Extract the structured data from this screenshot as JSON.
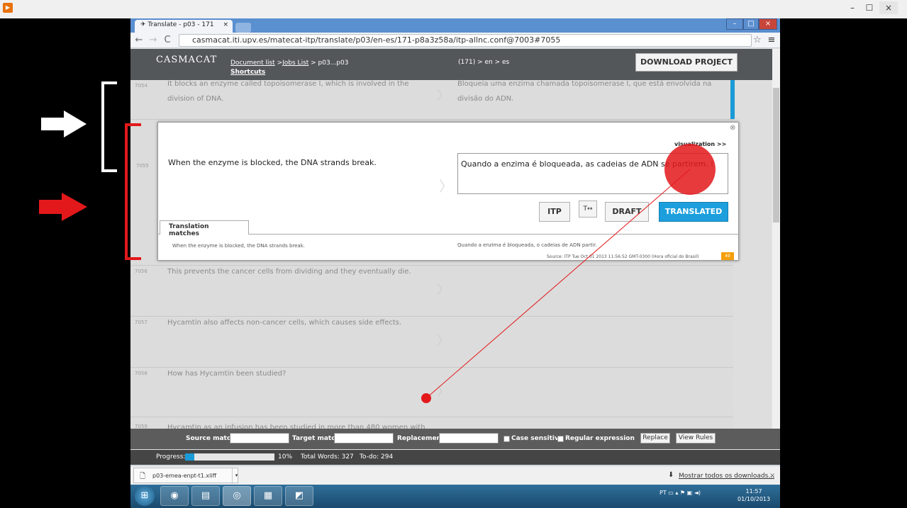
{
  "browser": {
    "tab_title": "Translate - p03 - 171",
    "tab_close": "×",
    "url": "casmacat.iti.upv.es/matecat-itp/translate/p03/en-es/171-p8a3z58a/itp-allnc.conf@7003#7055"
  },
  "header": {
    "logo_text": "CASMACAT",
    "breadcrumb_doclist": "Document list",
    "breadcrumb_sep1": " >",
    "breadcrumb_jobslist": "Jobs List",
    "breadcrumb_rest": " > p03...p03",
    "shortcuts": "Shortcuts",
    "lang_pair": "(171) > en > es",
    "download_label": "DOWNLOAD PROJECT"
  },
  "segments": [
    {
      "id": "7054",
      "source": "It blocks an enzyme called topoisomerase I, which is involved in the division of DNA.",
      "target": "Bloqueia uma enzima chamada topoisomerase I, que está envolvida na divisão do ADN."
    },
    {
      "id": "7056",
      "source": "This prevents the cancer cells from dividing and they eventually die.",
      "target": ""
    },
    {
      "id": "7057",
      "source": "Hycamtin also affects non-cancer cells, which causes side effects.",
      "target": ""
    },
    {
      "id": "7058",
      "source": "How has Hycamtin been studied?",
      "target": ""
    },
    {
      "id": "7059",
      "source": "Hycamtin as an infusion has been studied in more than 480 women with",
      "target": ""
    }
  ],
  "active_segment": {
    "id": "7055",
    "source": "When the enzyme is blocked, the DNA strands break.",
    "target": "Quando a enzima é bloqueada, as cadeias de ADN se partirem.",
    "visualization_link": "visualization >>",
    "close_icon": "⊗",
    "buttons": {
      "itp": "ITP",
      "toggle": "T↔",
      "draft": "DRAFT",
      "translated": "TRANSLATED"
    },
    "matches_tab": "Translation matches",
    "match_source": "When the enzyme is blocked, the DNA strands break.",
    "match_target": "Quando a enzima é bloqueada, o cadeias de ADN partir.",
    "match_meta": "Source: ITP   Tue Oct 01 2013 11:56:52 GMT-0300 (Hora oficial do Brasil)",
    "match_score": "49"
  },
  "findbar": {
    "source_match": "Source match",
    "target_match": "Target match",
    "replacement": "Replacement",
    "case_sensitive": "Case sensitive",
    "regular_expression": "Regular expression",
    "replace_btn": "Replace",
    "view_rules_btn": "View Rules"
  },
  "progress": {
    "label": "Progress:",
    "percent_text": "10%",
    "percent": 10,
    "total_words": "Total Words: 327",
    "todo": "To-do: 294"
  },
  "downloads": {
    "file": "p03-emea-enpt-t1.xliff",
    "show_all": "Mostrar todos os downloads..."
  },
  "taskbar": {
    "tray_lang": "PT",
    "time": "11:57",
    "date": "01/10/2013"
  },
  "colors": {
    "accent_blue": "#1a9bd7",
    "translated_btn": "#1c9fdc",
    "score_badge": "#f59e0b",
    "annotation_red": "#e3181b",
    "annotation_white": "#ffffff"
  }
}
